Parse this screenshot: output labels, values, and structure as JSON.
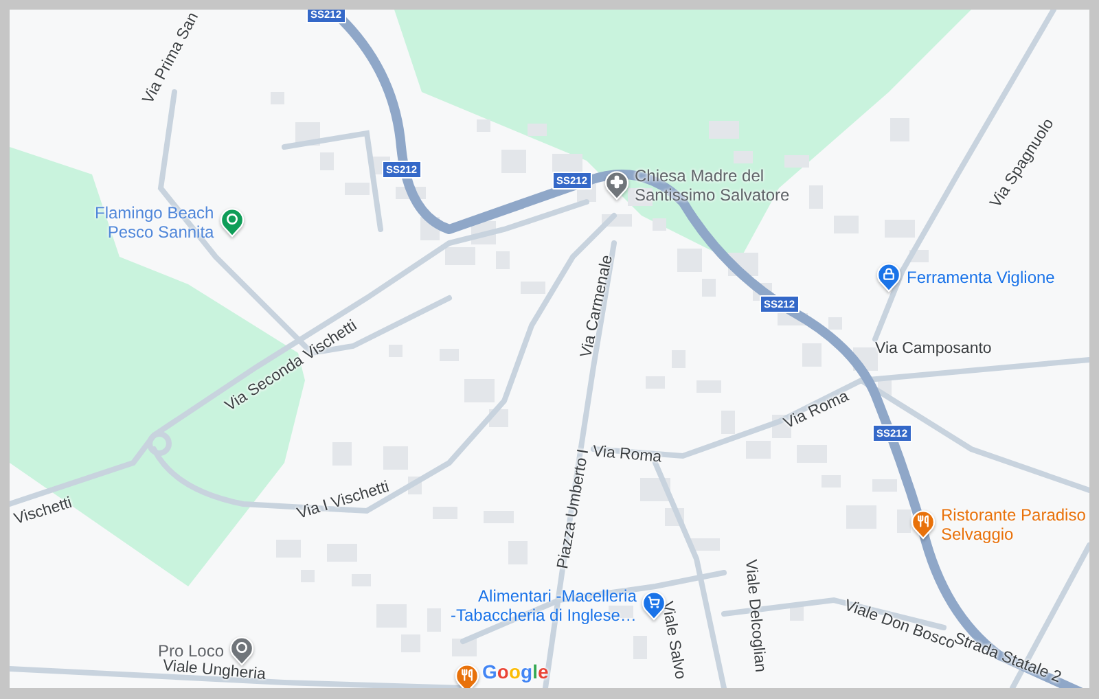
{
  "map": {
    "streets": [
      {
        "name": "Via Prima San"
      },
      {
        "name": "Via Seconda Vischetti"
      },
      {
        "name": "Vischetti"
      },
      {
        "name": "Via I Vischetti"
      },
      {
        "name": "Via Carmenale"
      },
      {
        "name": "Via Roma"
      },
      {
        "name": "Via Roma"
      },
      {
        "name": "Via Camposanto"
      },
      {
        "name": "Via Spagnuolo"
      },
      {
        "name": "Piazza Umberto I"
      },
      {
        "name": "Viale Salvo"
      },
      {
        "name": "Viale Delcoglian"
      },
      {
        "name": "Viale Don Bosco"
      },
      {
        "name": "Strada Statale 2"
      },
      {
        "name": "Viale Ungheria"
      }
    ],
    "road_shields": [
      {
        "label": "SS212"
      },
      {
        "label": "SS212"
      },
      {
        "label": "SS212"
      },
      {
        "label": "SS212"
      },
      {
        "label": "SS212"
      }
    ],
    "places": [
      {
        "kind": "park",
        "label": "Flamingo Beach\nPesco Sannita",
        "color": "#0f9d58"
      },
      {
        "kind": "church",
        "label": "Chiesa Madre del\nSantissimo Salvatore",
        "color": "#70757a"
      },
      {
        "kind": "shop",
        "label": "Ferramenta Viglione",
        "color": "#1a73e8"
      },
      {
        "kind": "restaurant",
        "label": "Ristorante Paradiso\nSelvaggio",
        "color": "#e8710a"
      },
      {
        "kind": "grocery",
        "label": "Alimentari -Macelleria\n-Tabaccheria di Inglese…",
        "color": "#1a73e8"
      },
      {
        "kind": "info",
        "label": "Pro Loco",
        "color": "#70757a"
      },
      {
        "kind": "restaurant",
        "color": "#e8710a"
      }
    ],
    "logo": "Google"
  }
}
